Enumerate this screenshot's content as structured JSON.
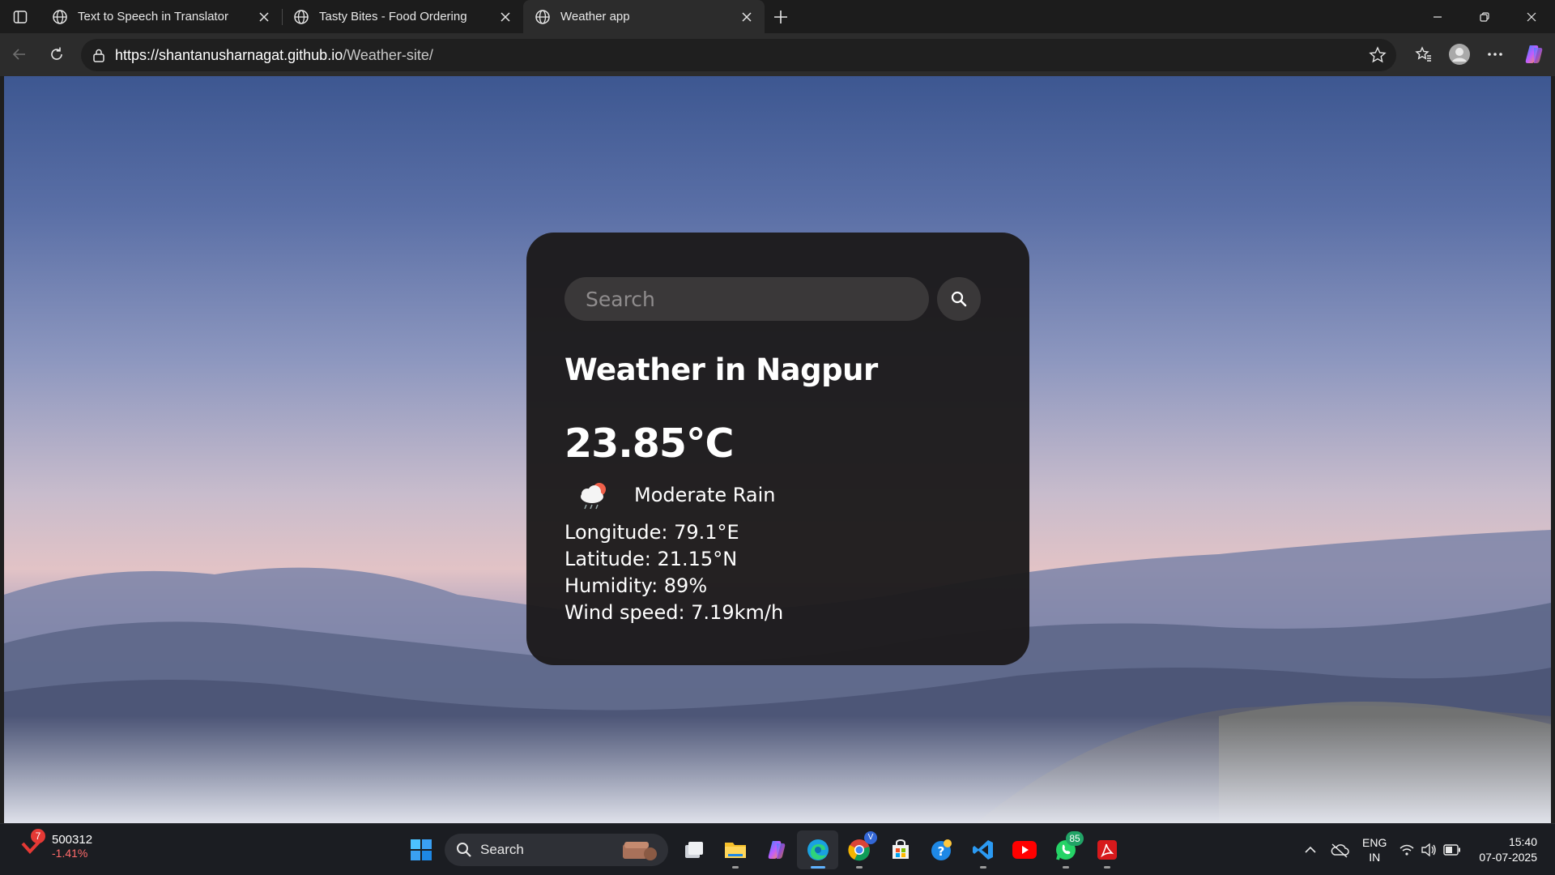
{
  "browser": {
    "tabs": [
      {
        "title": "Text to Speech in Translator"
      },
      {
        "title": "Tasty Bites - Food Ordering"
      },
      {
        "title": "Weather app"
      }
    ],
    "url_host": "https://shantanusharnagat.github.io",
    "url_path": "/Weather-site/"
  },
  "weather": {
    "search_placeholder": "Search",
    "heading": "Weather in Nagpur",
    "temperature": "23.85°C",
    "condition": "Moderate Rain",
    "longitude": "Longitude: 79.1°E",
    "latitude": "Latitude: 21.15°N",
    "humidity": "Humidity: 89%",
    "wind": "Wind speed: 7.19km/h"
  },
  "taskbar": {
    "stock_badge": "7",
    "stock_value": "500312",
    "stock_change": "-1.41%",
    "search_label": "Search",
    "whatsapp_badge": "85",
    "chrome_badge": "V",
    "lang_top": "ENG",
    "lang_bottom": "IN",
    "time": "15:40",
    "date": "07-07-2025"
  },
  "colors": {
    "card_bg": "#1c1a1b",
    "input_bg": "#3a3839",
    "accent_edge": "#0078d4",
    "stock_negative": "#ff6b6b"
  }
}
